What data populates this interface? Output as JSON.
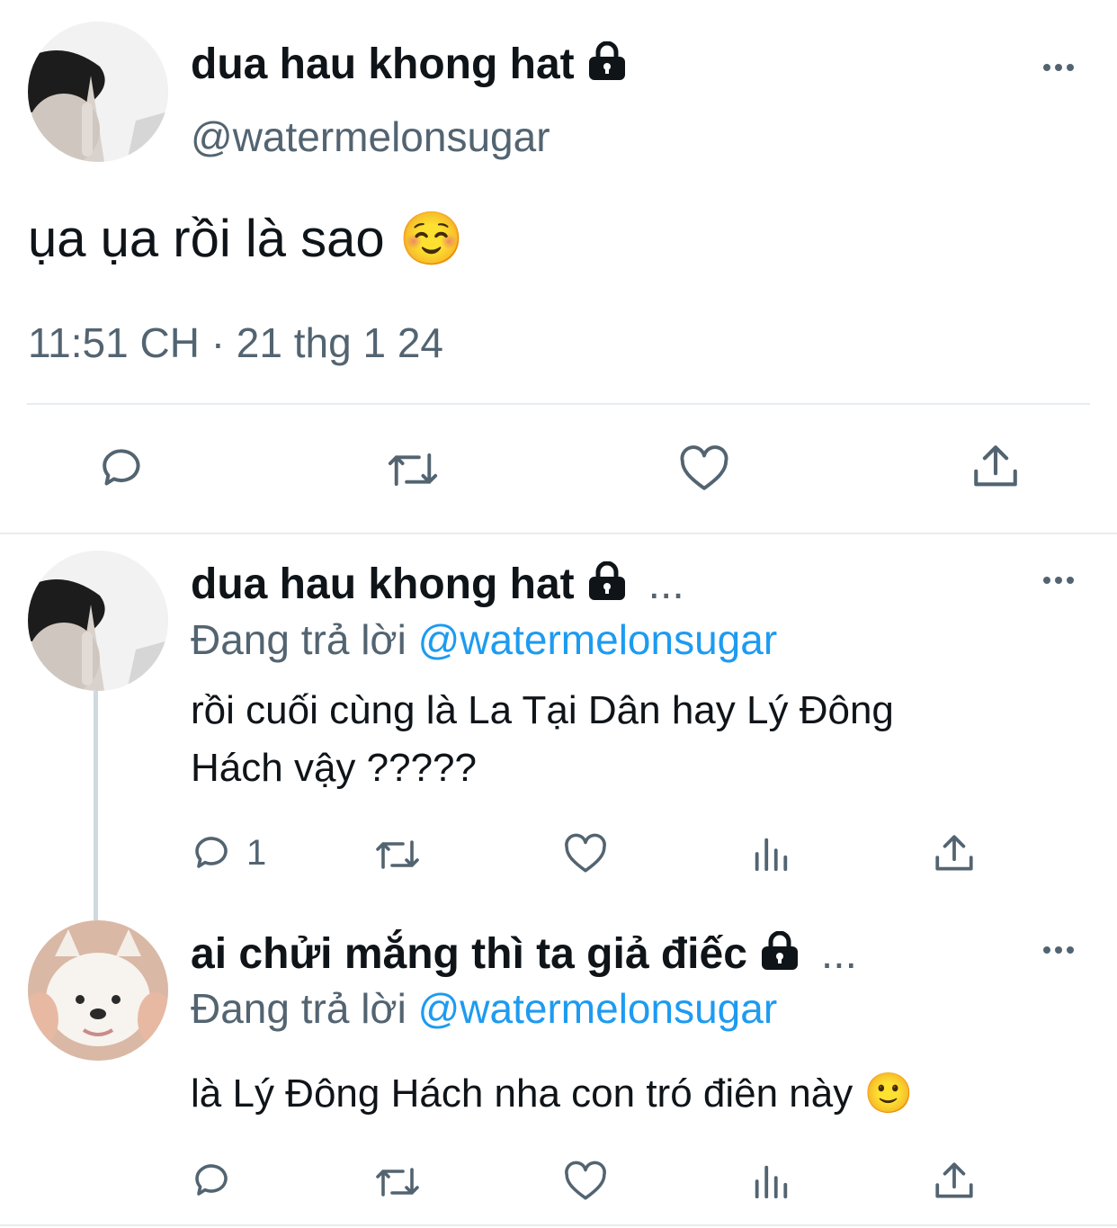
{
  "main_tweet": {
    "author_name": "dua hau khong hat",
    "handle": "@watermelonsugar",
    "text": "ụa ụa rồi là sao ☺️",
    "timestamp": "11:51 CH · 21 thg 1 24",
    "actions": [
      "reply-icon",
      "retweet-icon",
      "like-icon",
      "share-icon"
    ]
  },
  "replies": [
    {
      "author_name": "dua hau khong hat",
      "trailing": "...",
      "replying_prefix": "Đang trả lời",
      "replying_handle": "@watermelonsugar",
      "text_line1": "rồi cuối cùng là La Tại Dân hay Lý Đông",
      "text_line2": "Hách vậy ?????",
      "reply_count": "1"
    },
    {
      "author_name": "ai chửi mắng thì ta giả điếc",
      "trailing": "...",
      "replying_prefix": "Đang trả lời",
      "replying_handle": "@watermelonsugar",
      "text": "là Lý Đông Hách nha con tró điên này 🙂"
    }
  ],
  "colors": {
    "text": "#0f1419",
    "muted": "#536471",
    "link": "#1d9bf0",
    "divider": "#e6ecf0"
  }
}
